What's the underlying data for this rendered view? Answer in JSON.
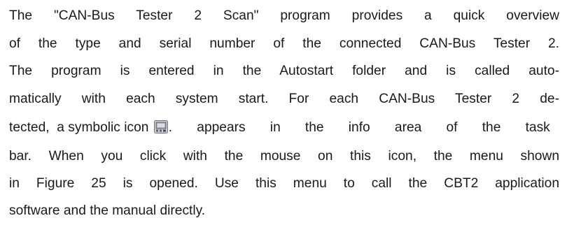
{
  "paragraph": {
    "line1": "The \"CAN-Bus Tester 2 Scan\" program provides a quick overview",
    "line2": "of the type and serial number of the connected CAN-Bus Tester 2.",
    "line3": "The program is entered in the Autostart folder and is called auto-",
    "line4": "matically with each system start. For each CAN-Bus Tester 2 de-",
    "line5_before_icon": "tected,  a symbolic icon ",
    "line5_after_icon": ". appears in the info area of the task",
    "line6": "bar. When you click with the mouse on this icon, the menu shown",
    "line7": "in Figure 25 is opened. Use this menu to call the CBT2 application",
    "line8": "software and the manual directly.",
    "icon_name": "can-bus-tester-tray-icon"
  }
}
